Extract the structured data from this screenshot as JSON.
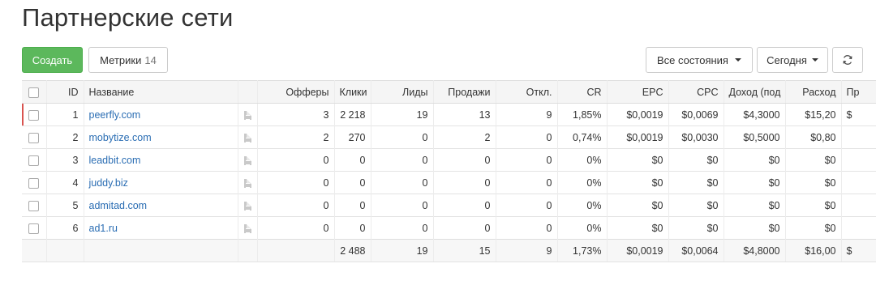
{
  "page_title": "Партнерские сети",
  "toolbar": {
    "create_label": "Создать",
    "metrics_label": "Метрики",
    "metrics_count": "14",
    "states_label": "Все состояния",
    "period_label": "Сегодня"
  },
  "table": {
    "columns": [
      "",
      "ID",
      "Название",
      "",
      "Офферы",
      "Клики",
      "Лиды",
      "Продажи",
      "Откл.",
      "CR",
      "EPC",
      "CPC",
      "Доход (под",
      "Расход",
      "Пр"
    ],
    "rows": [
      {
        "id": "1",
        "name": "peerfly.com",
        "offers": "3",
        "clicks": "2 218",
        "leads": "19",
        "sales": "13",
        "rejected": "9",
        "cr": "1,85%",
        "epc": "$0,0019",
        "cpc": "$0,0069",
        "income": "$4,3000",
        "expense": "$15,20",
        "profit": "$"
      },
      {
        "id": "2",
        "name": "mobytize.com",
        "offers": "2",
        "clicks": "270",
        "leads": "0",
        "sales": "2",
        "rejected": "0",
        "cr": "0,74%",
        "epc": "$0,0019",
        "cpc": "$0,0030",
        "income": "$0,5000",
        "expense": "$0,80",
        "profit": ""
      },
      {
        "id": "3",
        "name": "leadbit.com",
        "offers": "0",
        "clicks": "0",
        "leads": "0",
        "sales": "0",
        "rejected": "0",
        "cr": "0%",
        "epc": "$0",
        "cpc": "$0",
        "income": "$0",
        "expense": "$0",
        "profit": ""
      },
      {
        "id": "4",
        "name": "juddy.biz",
        "offers": "0",
        "clicks": "0",
        "leads": "0",
        "sales": "0",
        "rejected": "0",
        "cr": "0%",
        "epc": "$0",
        "cpc": "$0",
        "income": "$0",
        "expense": "$0",
        "profit": ""
      },
      {
        "id": "5",
        "name": "admitad.com",
        "offers": "0",
        "clicks": "0",
        "leads": "0",
        "sales": "0",
        "rejected": "0",
        "cr": "0%",
        "epc": "$0",
        "cpc": "$0",
        "income": "$0",
        "expense": "$0",
        "profit": ""
      },
      {
        "id": "6",
        "name": "ad1.ru",
        "offers": "0",
        "clicks": "0",
        "leads": "0",
        "sales": "0",
        "rejected": "0",
        "cr": "0%",
        "epc": "$0",
        "cpc": "$0",
        "income": "$0",
        "expense": "$0",
        "profit": ""
      }
    ],
    "totals": {
      "clicks": "2 488",
      "leads": "19",
      "sales": "15",
      "rejected": "9",
      "cr": "1,73%",
      "epc": "$0,0019",
      "cpc": "$0,0064",
      "income": "$4,8000",
      "expense": "$16,00",
      "profit": "$"
    }
  },
  "colors": {
    "create_button": "#5cb85c",
    "link": "#2a6db3",
    "selected_marker": "#d9534f"
  },
  "icons": {
    "row_doc": "document-icon",
    "refresh": "refresh-icon",
    "dropdown": "caret-down-icon"
  }
}
